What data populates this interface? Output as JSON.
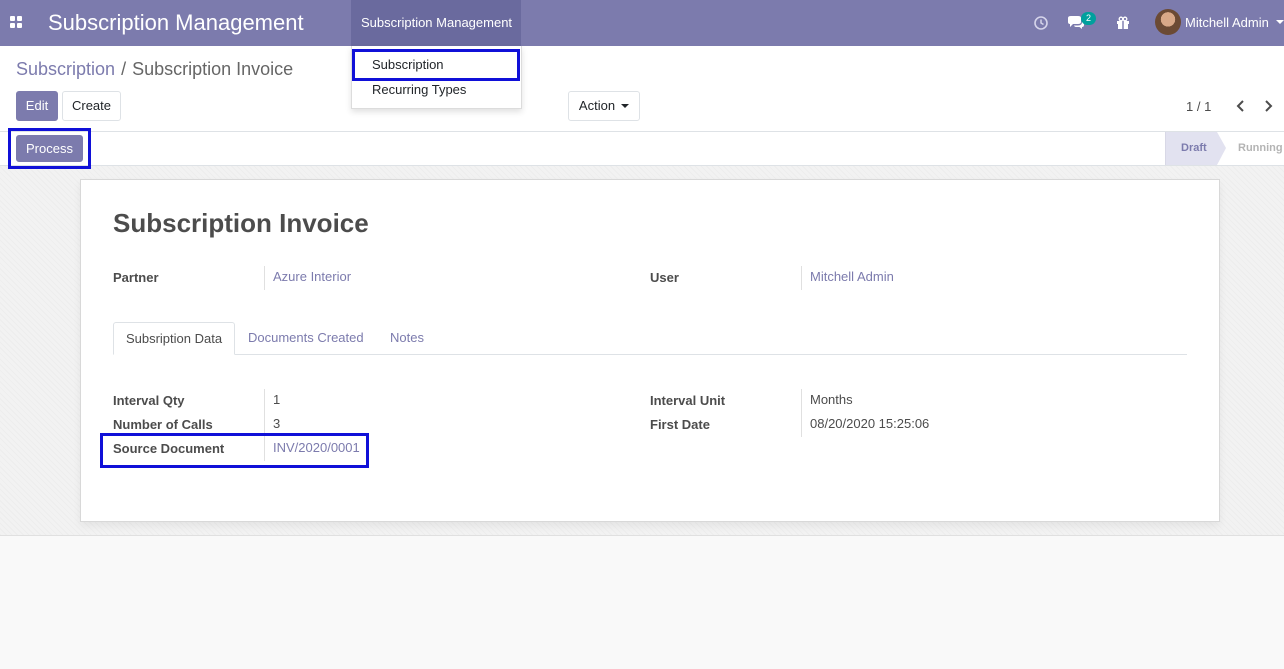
{
  "navbar": {
    "brand": "Subscription Management",
    "active_menu": "Subscription Management",
    "chat_count": "2",
    "user_name": "Mitchell Admin"
  },
  "dropdown": {
    "items": [
      {
        "label": "Subscription"
      },
      {
        "label": "Recurring Types"
      }
    ]
  },
  "breadcrumb": {
    "parent": "Subscription",
    "separator": "/",
    "current": "Subscription Invoice"
  },
  "toolbar": {
    "edit_label": "Edit",
    "create_label": "Create",
    "action_label": "Action"
  },
  "pager": {
    "value": "1 / 1"
  },
  "statusbar": {
    "process_label": "Process",
    "stages": [
      {
        "label": "Draft",
        "active": true
      },
      {
        "label": "Running",
        "active": false
      }
    ]
  },
  "form": {
    "title": "Subscription Invoice",
    "partner": {
      "label": "Partner",
      "value": "Azure Interior"
    },
    "user": {
      "label": "User",
      "value": "Mitchell Admin"
    },
    "tabs": [
      {
        "label": "Subsription Data"
      },
      {
        "label": "Documents Created"
      },
      {
        "label": "Notes"
      }
    ],
    "fields_left": [
      {
        "label": "Interval Qty",
        "value": "1"
      },
      {
        "label": "Number of Calls",
        "value": "3"
      },
      {
        "label": "Source Document",
        "value": "INV/2020/0001"
      }
    ],
    "fields_right": [
      {
        "label": "Interval Unit",
        "value": "Months"
      },
      {
        "label": "First Date",
        "value": "08/20/2020 15:25:06"
      }
    ]
  },
  "colors": {
    "brand": "#7c7bad",
    "highlight": "#1010d8"
  }
}
